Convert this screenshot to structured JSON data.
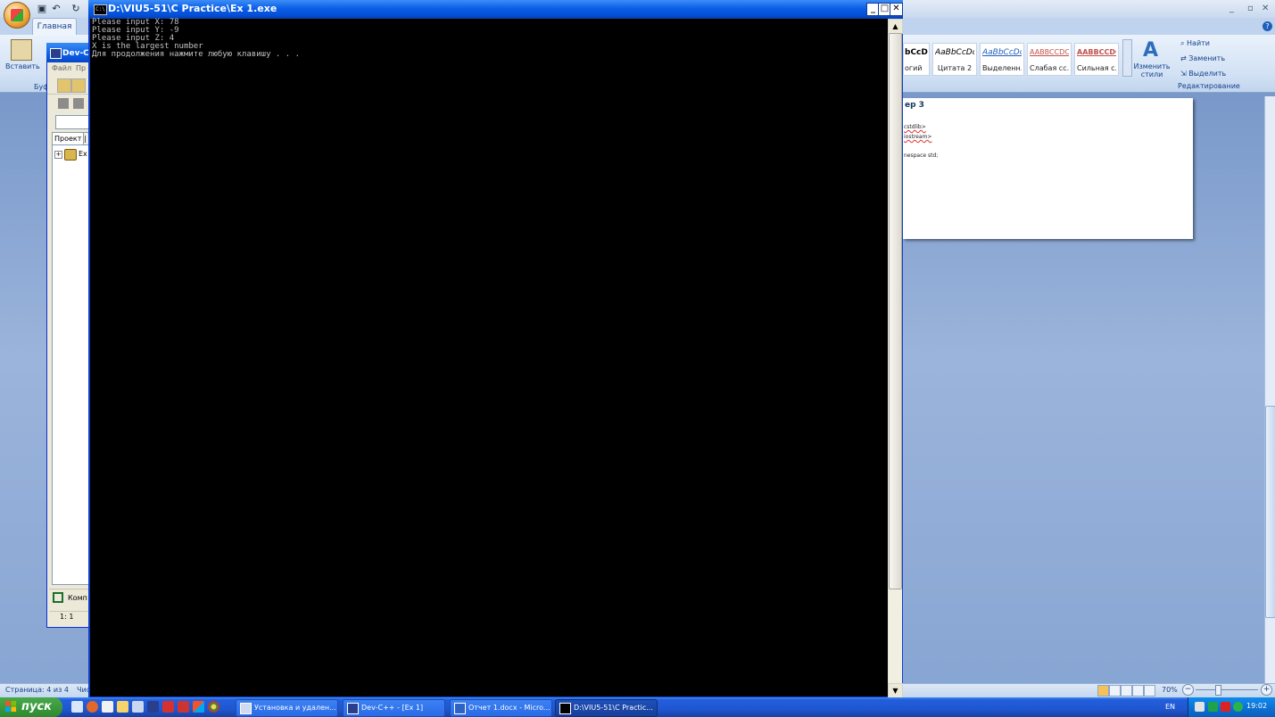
{
  "console": {
    "title": "D:\\VIU5-51\\C Practice\\Ex 1.exe",
    "icon": "C:\\",
    "lines": [
      "Please input X: 78",
      "Please input Y: -9",
      "Please input Z: 4",
      "X is the largest number",
      "Для продолжения нажмите любую клавишу . . ."
    ],
    "buttons": {
      "minimize": "_",
      "maximize": "□",
      "close": "✕"
    }
  },
  "devcpp": {
    "title": "Dev-C",
    "menu": [
      "Файл",
      "Пр"
    ],
    "tabs": {
      "project": "Проект",
      "second": "|"
    },
    "tree": {
      "expander": "+",
      "item": "Ex"
    },
    "compile_tab": "Комп",
    "cursor_pos": "1: 1"
  },
  "word": {
    "ribbon_tab_home": "Главная",
    "paste_label": "Вставить",
    "clipboard_label": "Буф",
    "styles": [
      {
        "sample": "bCcDc",
        "name": "огий",
        "color": "#222222"
      },
      {
        "sample": "AaBbCcDc",
        "name": "Цитата 2",
        "color": "#222222"
      },
      {
        "sample": "AaBbCcDc",
        "name": "Выделенн...",
        "color": "#1f5fbf"
      },
      {
        "sample": "AaBbCcDc",
        "name": "Слабая сс...",
        "color": "#c0504d"
      },
      {
        "sample": "AaBbCcDc",
        "name": "Сильная с...",
        "color": "#c0504d"
      }
    ],
    "change_styles_line1": "Изменить",
    "change_styles_line2": "стили",
    "find": "Найти",
    "replace": "Заменить",
    "select": "Выделить",
    "edit_group": "Редактирование",
    "help": "?",
    "window_buttons": {
      "minimize": "_",
      "maximize": "▫",
      "close": "✕"
    },
    "doc_heading": "ер 3",
    "doc_lines": [
      "cstdlib>",
      "iostream>",
      "",
      "nespace std;"
    ],
    "status_page": "Страница: 4 из 4",
    "status_words": "Чис",
    "zoom": "70%",
    "zoom_minus": "−",
    "zoom_plus": "+"
  },
  "taskbar": {
    "start": "пуск",
    "buttons": [
      {
        "label": "Установка и удален...",
        "active": false
      },
      {
        "label": "Dev-C++ - [Ex 1]",
        "active": false
      },
      {
        "label": "Отчет 1.docx - Micro...",
        "active": false
      },
      {
        "label": "D:\\VIU5-51\\C Practic...",
        "active": true
      }
    ],
    "lang": "EN",
    "clock": "19:02"
  }
}
